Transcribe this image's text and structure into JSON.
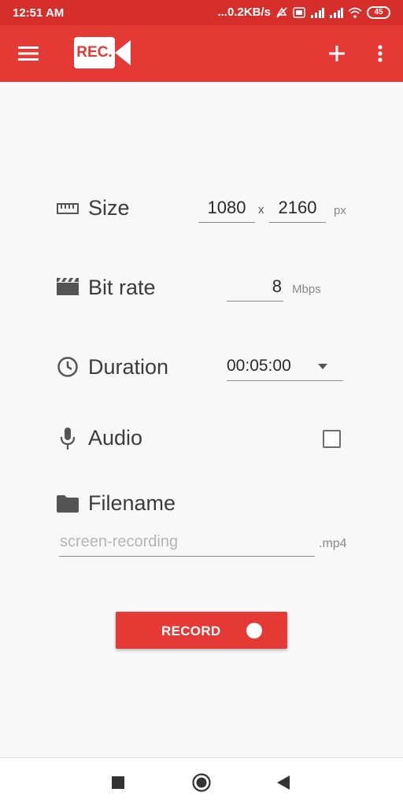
{
  "status_bar": {
    "time": "12:51 AM",
    "net_speed": "...0.2KB/s",
    "battery": "45"
  },
  "app_bar": {
    "logo_text": "REC.",
    "menu_icon": "hamburger-icon",
    "add_icon": "plus-icon",
    "overflow_icon": "more-vert-icon",
    "colors": {
      "primary": "#e53935",
      "status": "#d62f2b"
    }
  },
  "size": {
    "label": "Size",
    "width": "1080",
    "separator": "x",
    "height": "2160",
    "unit": "px"
  },
  "bitrate": {
    "label": "Bit rate",
    "value": "8",
    "unit": "Mbps"
  },
  "duration": {
    "label": "Duration",
    "value": "00:05:00"
  },
  "audio": {
    "label": "Audio",
    "checked": false
  },
  "filename": {
    "label": "Filename",
    "placeholder": "screen-recording",
    "extension": ".mp4"
  },
  "record_button": {
    "label": "RECORD"
  },
  "nav_bar": {
    "items": [
      "stop-square-icon",
      "home-circle-icon",
      "back-triangle-icon"
    ]
  }
}
